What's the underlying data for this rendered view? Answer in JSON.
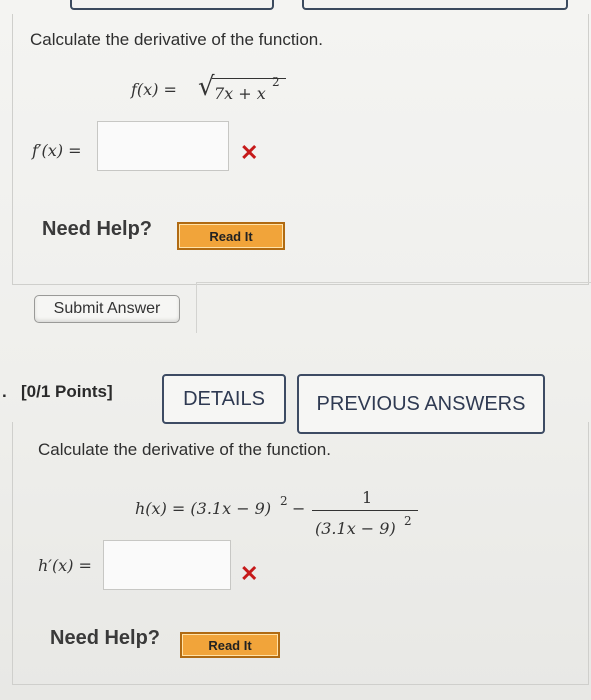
{
  "q1": {
    "prompt": "Calculate the derivative of the function.",
    "function_lhs": "f(x) = ",
    "radical": "√",
    "radicand": "7x + x",
    "radicand_exp": "2",
    "answer_label": "f′(x) =",
    "answer_value": "",
    "result_mark": "✕",
    "need_help": "Need Help?",
    "read_it": "Read It",
    "submit": "Submit Answer"
  },
  "q2": {
    "number_prefix": ".",
    "points": "[0/1 Points]",
    "details": "DETAILS",
    "previous_answers": "PREVIOUS ANSWERS",
    "prompt": "Calculate the derivative of the function.",
    "function_lhs": "h(x) = (3.1x − 9)",
    "function_exp": "2",
    "minus": "−",
    "numerator": "1",
    "denominator": "(3.1x − 9)",
    "denominator_exp": "2",
    "answer_label": "h′(x) =",
    "answer_value": "",
    "result_mark": "✕",
    "need_help": "Need Help?",
    "read_it": "Read It"
  },
  "colors": {
    "read_it_bg": "#f1a43a",
    "error_mark": "#c61a1a",
    "tab_border": "#3d4b63"
  }
}
